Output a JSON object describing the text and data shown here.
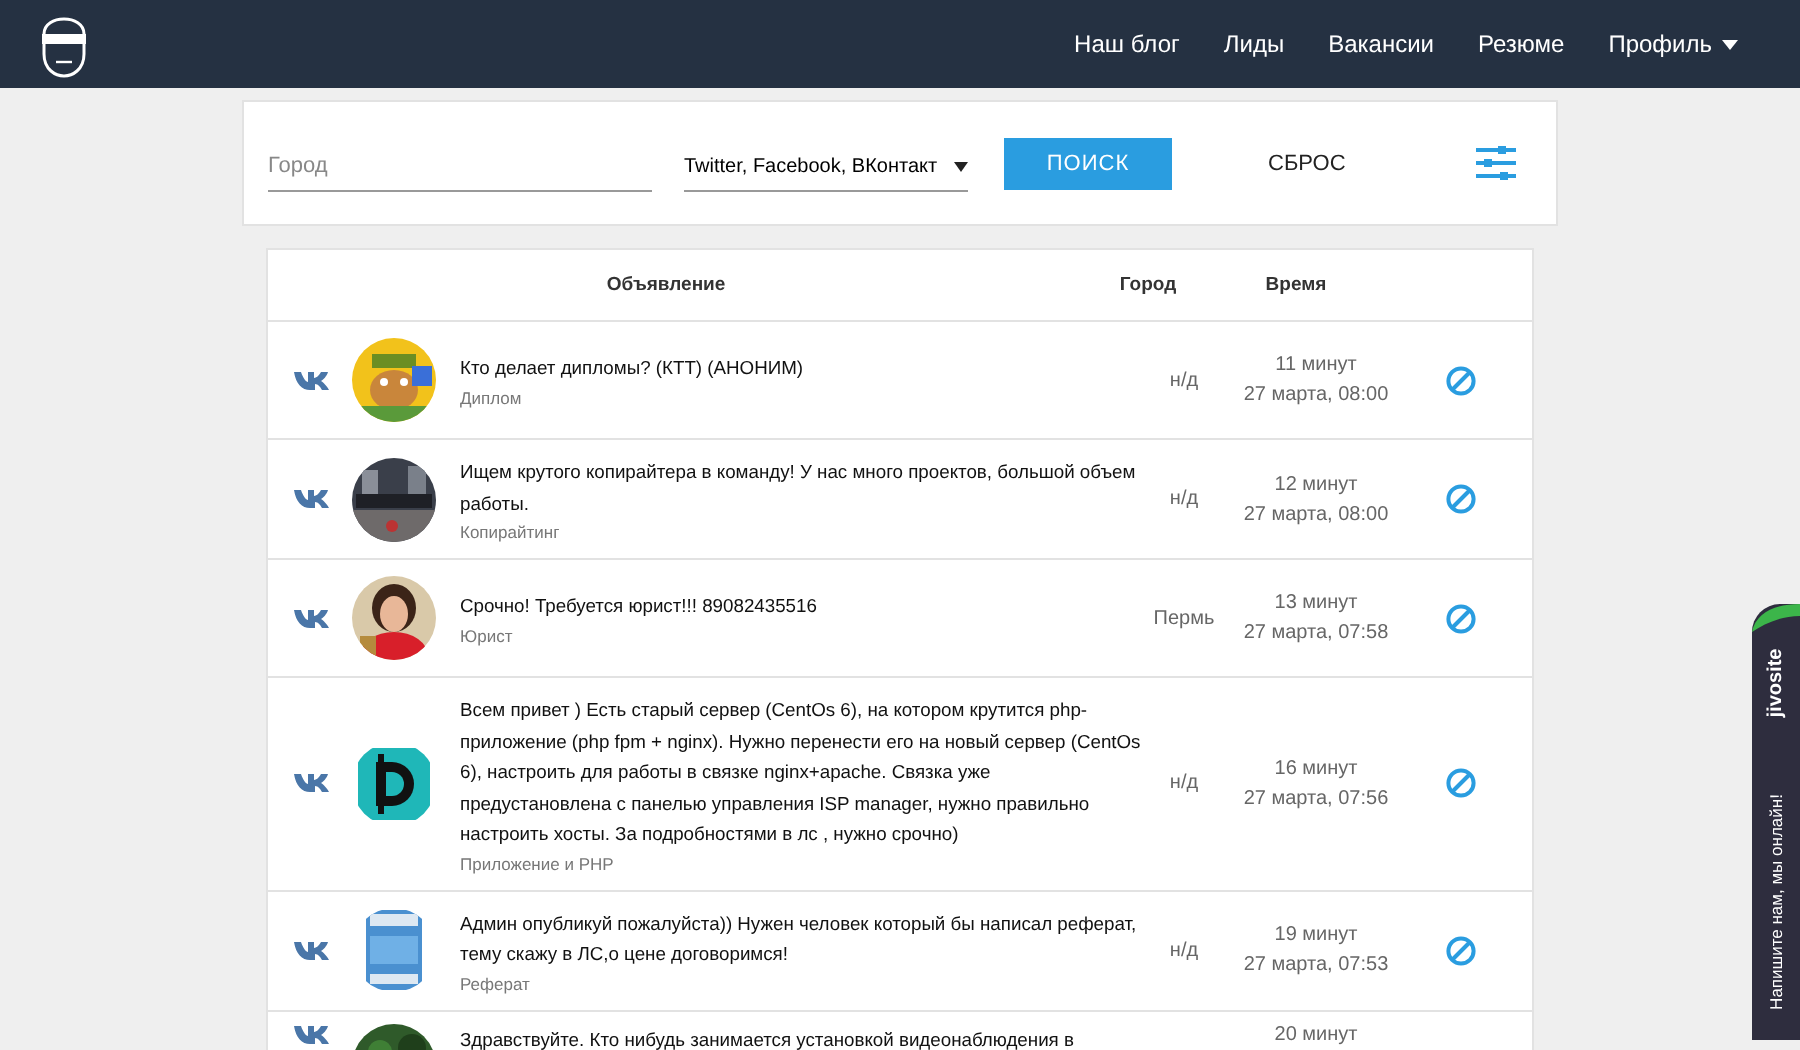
{
  "nav": {
    "items": [
      {
        "label": "Наш блог"
      },
      {
        "label": "Лиды"
      },
      {
        "label": "Вакансии"
      },
      {
        "label": "Резюме"
      },
      {
        "label": "Профиль",
        "dropdown": true
      }
    ]
  },
  "filters": {
    "city": {
      "placeholder": "Город"
    },
    "sources": {
      "value": "Twitter, Facebook, ВКонтакт"
    },
    "search_button": "ПОИСК",
    "reset_button": "СБРОС"
  },
  "table": {
    "columns": [
      "Объявление",
      "Город",
      "Время"
    ],
    "rows": [
      {
        "title": "Кто делает дипломы? (КТТ) (АНОНИМ)",
        "category": "Диплом",
        "city": "н/д",
        "ago": "11 минут",
        "date": "27 марта, 08:00"
      },
      {
        "title": "Ищем крутого копирайтера в команду! У нас много проектов, большой объем работы.",
        "category": "Копирайтинг",
        "city": "н/д",
        "ago": "12 минут",
        "date": "27 марта, 08:00"
      },
      {
        "title": "Срочно! Требуется юрист!!! 89082435516",
        "category": "Юрист",
        "city": "Пермь",
        "ago": "13 минут",
        "date": "27 марта, 07:58"
      },
      {
        "title": "Всем привет ) Есть старый сервер (CentOs 6), на котором крутится php-приложение (php fpm + nginx). Нужно перенести его на новый сервер (CentOs 6), настроить для работы в связке nginx+apache. Связка уже предустановлена с панелью управления ISP manager, нужно правильно настроить хосты. За подробностями в лс , нужно срочно)",
        "category": "Приложение и PHP",
        "city": "н/д",
        "ago": "16 минут",
        "date": "27 марта, 07:56"
      },
      {
        "title": "Админ опубликуй пожалуйста)) Нужен человек который бы написал реферат, тему скажу в ЛС,о цене договоримся!",
        "category": "Реферат",
        "city": "н/д",
        "ago": "19 минут",
        "date": "27 марта, 07:53"
      },
      {
        "title": "Здравствуйте. Кто нибудь занимается установкой видеонаблюдения в",
        "city": "",
        "ago": "20 минут"
      }
    ]
  },
  "chat_widget": {
    "brand": "jivosite",
    "label": "Напишите нам, мы онлайн!"
  }
}
